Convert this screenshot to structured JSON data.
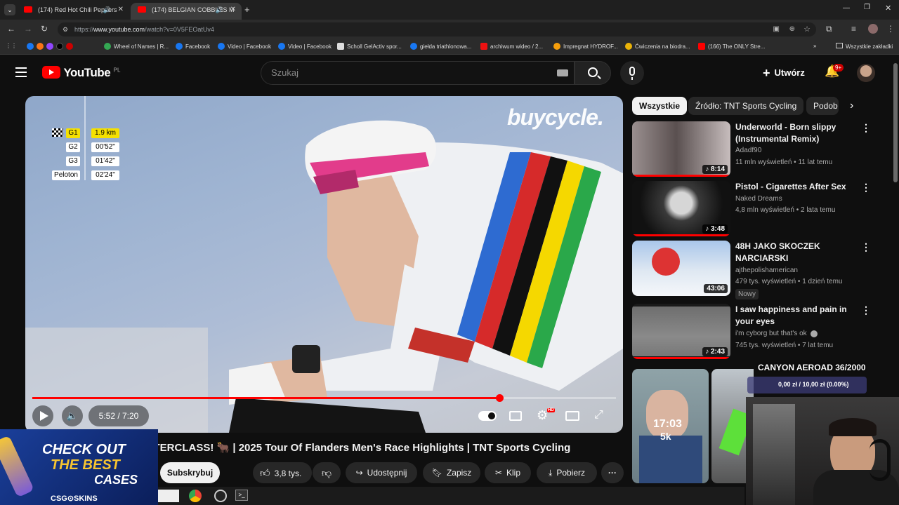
{
  "browser": {
    "tabs": [
      {
        "label": "(174) Red Hot Chili Peppers"
      },
      {
        "label": "(174) BELGIAN COBBLES M"
      }
    ],
    "url_prefix": "https://",
    "url_host": "www.youtube.com",
    "url_path": "/watch?v=0V5FEOatUv4",
    "bookmarks": [
      "Wheel of Names | R...",
      "Facebook",
      "Video | Facebook",
      "Video | Facebook",
      "Scholl GelActiv spor...",
      "giełda triathlonowa...",
      "archiwum wideo / 2...",
      "Impregnat HYDROF...",
      "Ćwiczenia na biodra...",
      "(166) The ONLY Stre..."
    ],
    "all_bookmarks": "Wszystkie zakładki"
  },
  "yt": {
    "logo_text": "YouTube",
    "country": "PL",
    "search_placeholder": "Szukaj",
    "create_label": "Utwórz",
    "notif_count": "9+"
  },
  "player": {
    "watermark": "buycycle.",
    "scoreboard": [
      {
        "name": "G1",
        "value": "1.9 km"
      },
      {
        "name": "G2",
        "value": "00'52\""
      },
      {
        "name": "G3",
        "value": "01'42\""
      },
      {
        "name": "Peloton",
        "value": "02'24\""
      }
    ],
    "time": "5:52 / 7:20",
    "progress_fraction": 0.8,
    "settings_badge": "HD"
  },
  "sidebar": {
    "chips": [
      "Wszystkie",
      "Źródło: TNT Sports Cycling",
      "Podob"
    ],
    "videos": [
      {
        "title": "Underworld - Born slippy (Instrumental Remix)",
        "channel": "Adadf90",
        "meta": "11 mln wyświetleń • 11 lat temu",
        "duration": "8:14",
        "badge": ""
      },
      {
        "title": "Pistol - Cigarettes After Sex",
        "channel": "Naked Dreams",
        "meta": "4,8 mln wyświetleń • 2 lata temu",
        "duration": "3:48",
        "badge": ""
      },
      {
        "title": "48H JAKO SKOCZEK NARCIARSKI",
        "channel": "ajthepolishamerican",
        "meta": "479 tys. wyświetleń • 1 dzień temu",
        "duration": "43:06",
        "badge": "Nowy"
      },
      {
        "title": "I saw happiness and pain in your eyes",
        "channel": "i'm cyborg but that's ok",
        "meta": "745 tys. wyświetleń • 7 lat temu",
        "duration": "2:43",
        "badge": ""
      }
    ],
    "short_label_time": "17:03",
    "short_label_sub": "5k"
  },
  "video": {
    "title": "BELGIAN COBBLES MASTERCLASS! 🐂 | 2025 Tour Of Flanders Men's Race Highlights | TNT Sports Cycling",
    "subscribe": "Subskrybuj",
    "likes": "3,8 tys.",
    "share": "Udostępnij",
    "save": "Zapisz",
    "clip": "Klip",
    "download": "Pobierz"
  },
  "overlays": {
    "ad_line1": "CHECK OUT",
    "ad_line2": "THE BEST",
    "ad_line3": "CASES",
    "ad_brand": "CSG⊙SKINS",
    "goal_title": "CANYON AEROAD 36/2000",
    "goal_progress": "0,00 zł / 10,00 zł (0.00%)"
  }
}
